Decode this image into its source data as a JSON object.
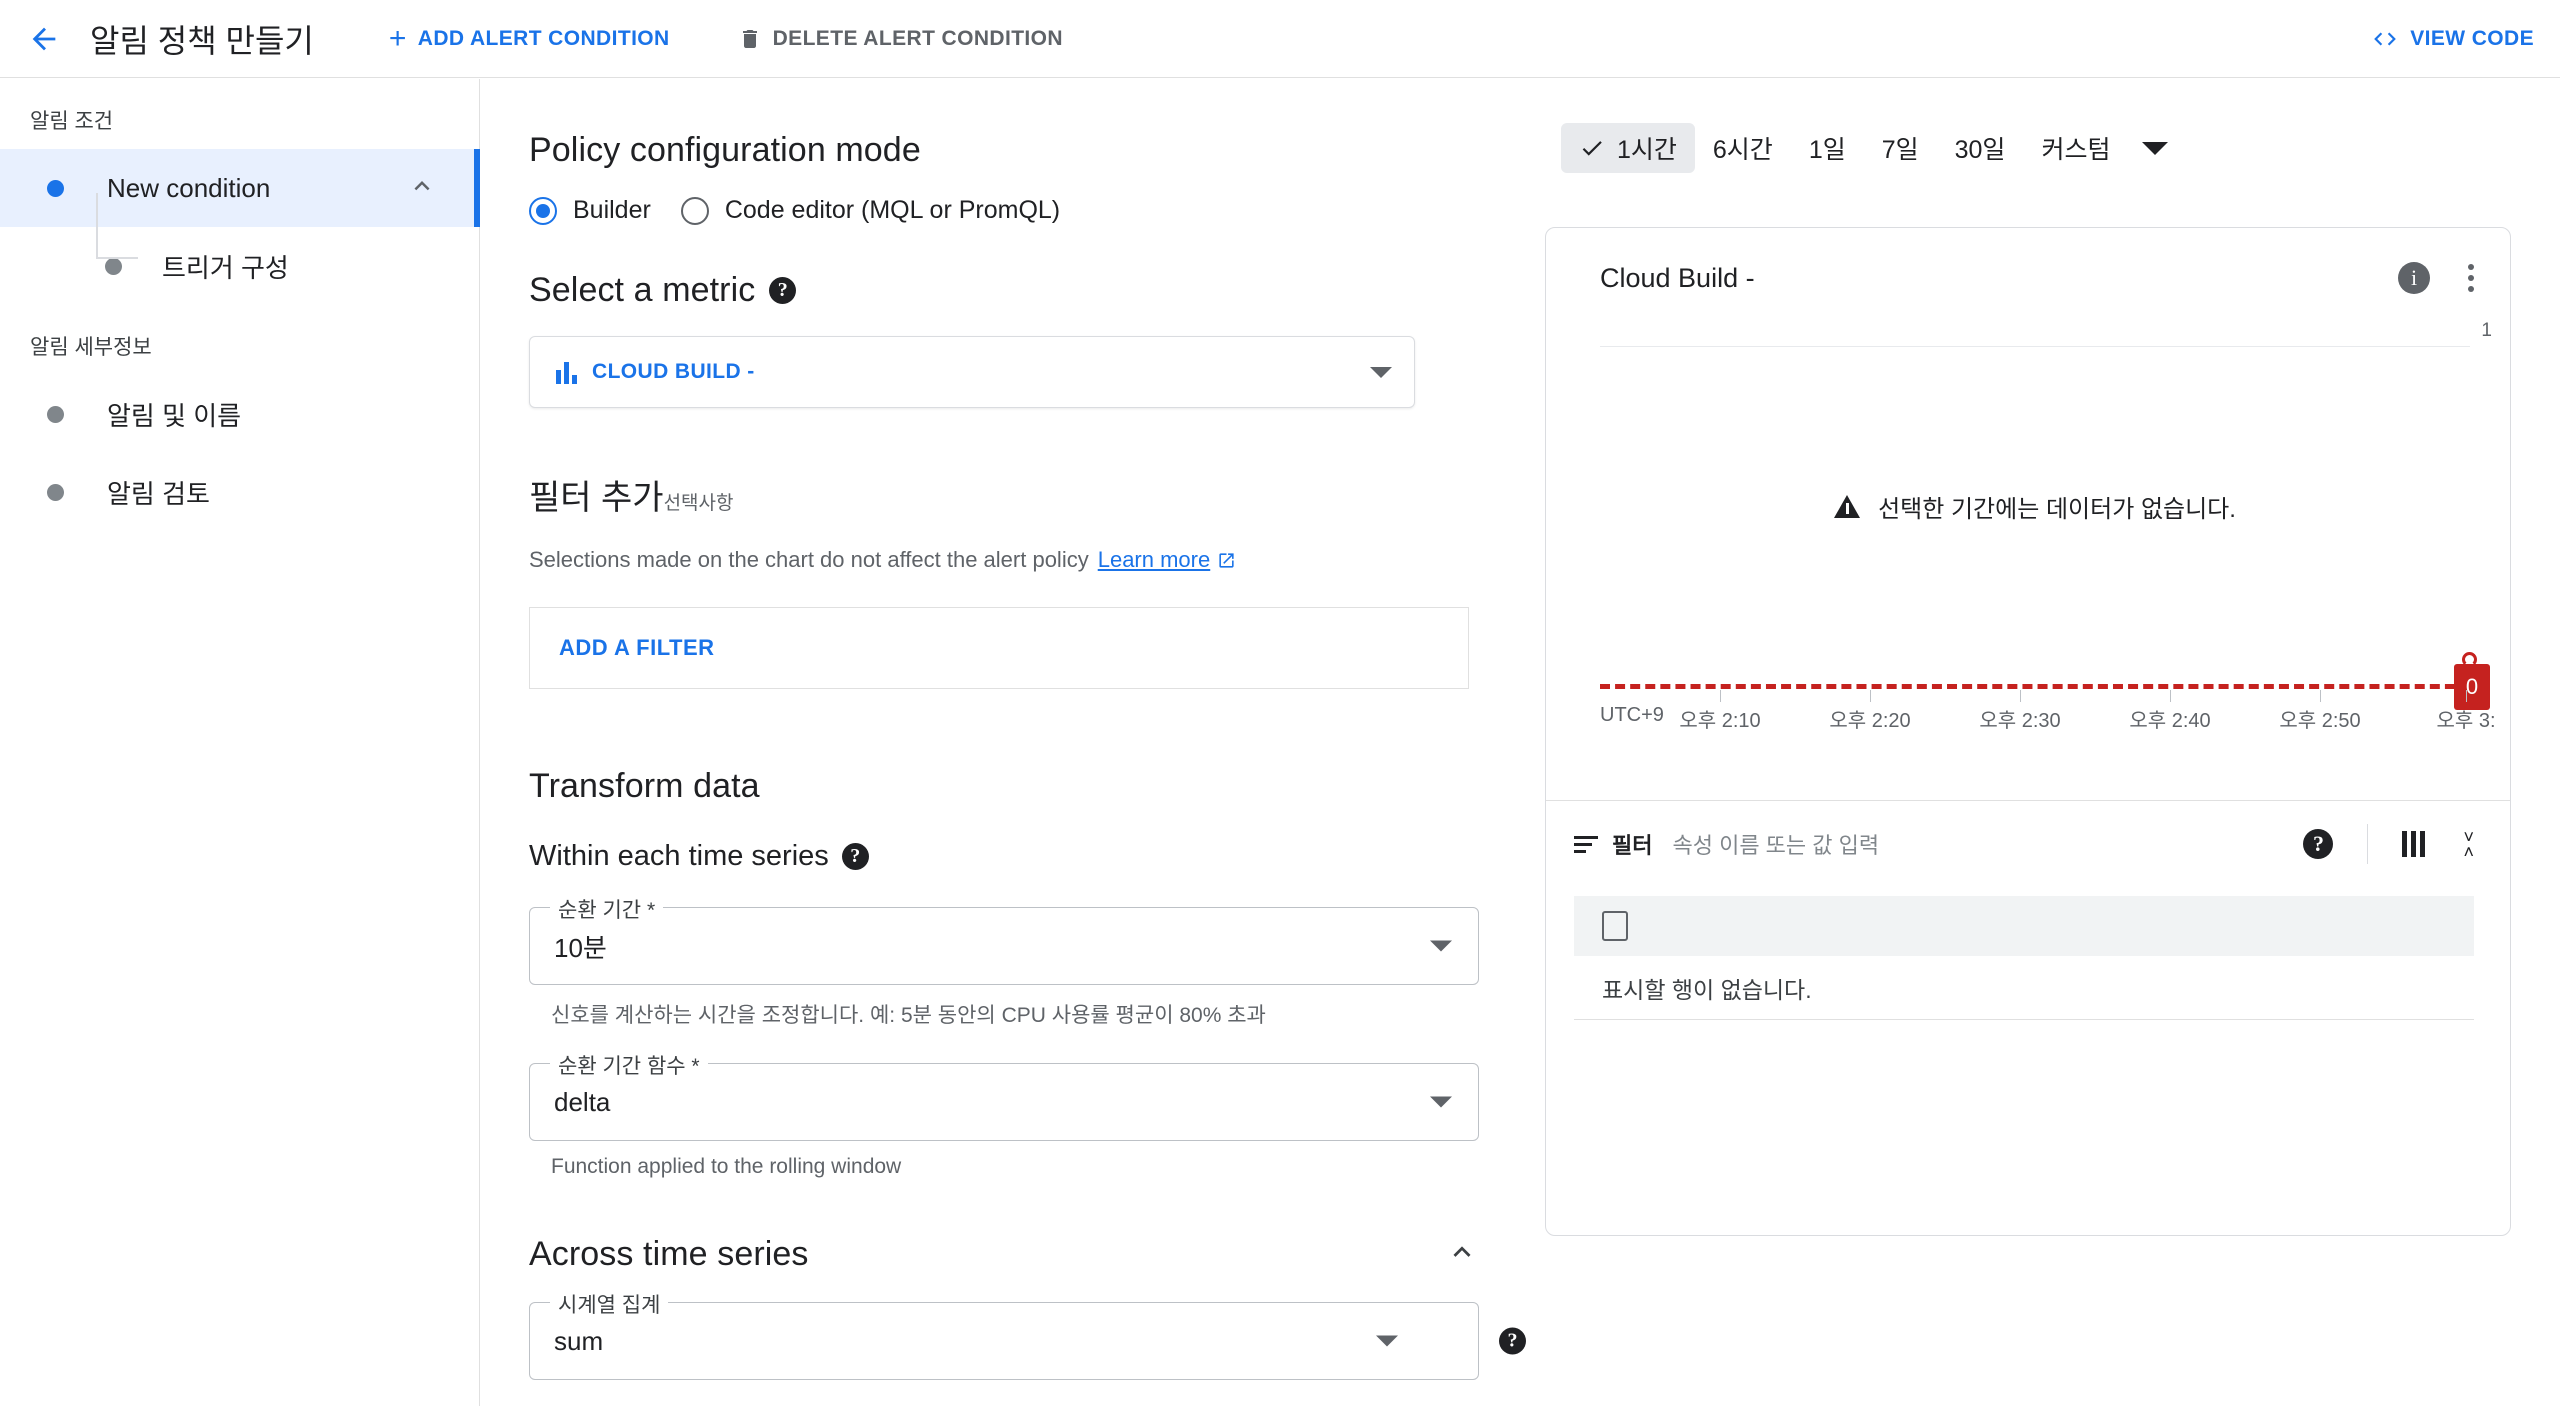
{
  "topbar": {
    "back_icon": "arrow-left-icon",
    "title": "알림 정책 만들기",
    "add_condition": "ADD ALERT CONDITION",
    "delete_condition": "DELETE ALERT CONDITION",
    "view_code": "VIEW CODE"
  },
  "sidebar": {
    "group1_label": "알림 조건",
    "group2_label": "알림 세부정보",
    "items": [
      {
        "label": "New condition",
        "active": true
      },
      {
        "label": "트리거 구성",
        "active": false
      },
      {
        "label": "알림 및 이름",
        "active": false
      },
      {
        "label": "알림 검토",
        "active": false
      }
    ]
  },
  "main": {
    "policy_mode_heading": "Policy configuration mode",
    "mode_builder": "Builder",
    "mode_code_editor": "Code editor (MQL or PromQL)",
    "select_metric_heading": "Select a metric",
    "metric_value": "CLOUD BUILD -",
    "add_filter_heading": "필터 추가",
    "add_filter_optional": "선택사항",
    "note_text": "Selections made on the chart do not affect the alert policy",
    "note_link": "Learn more",
    "add_filter_button": "ADD A FILTER",
    "transform_heading": "Transform data",
    "within_each_heading": "Within each time series",
    "rolling_window_label": "순환 기간 *",
    "rolling_window_value": "10분",
    "rolling_window_help": "신호를 계산하는 시간을 조정합니다. 예: 5분 동안의 CPU 사용률 평균이 80% 초과",
    "rolling_fn_label": "순환 기간 함수 *",
    "rolling_fn_value": "delta",
    "rolling_fn_help": "Function applied to the rolling window",
    "across_heading": "Across time series",
    "series_agg_label": "시계열 집계",
    "series_agg_value": "sum"
  },
  "right": {
    "ranges": [
      {
        "label": "1시간",
        "selected": true
      },
      {
        "label": "6시간",
        "selected": false
      },
      {
        "label": "1일",
        "selected": false
      },
      {
        "label": "7일",
        "selected": false
      },
      {
        "label": "30일",
        "selected": false
      },
      {
        "label": "커스텀",
        "selected": false
      }
    ],
    "card_title": "Cloud Build -",
    "no_data_message": "선택한 기간에는 데이터가 없습니다.",
    "threshold_badge": "0",
    "table": {
      "filter_label": "필터",
      "filter_placeholder": "속성 이름 또는 값 입력",
      "empty_message": "표시할 행이 없습니다."
    }
  },
  "chart_data": {
    "type": "line",
    "title": "Cloud Build -",
    "xlabel": "",
    "ylabel": "",
    "timezone_label": "UTC+9",
    "x_tick_labels": [
      "오후 2:10",
      "오후 2:20",
      "오후 2:30",
      "오후 2:40",
      "오후 2:50",
      "오후 3:"
    ],
    "y_tick_labels": [
      "1"
    ],
    "ylim": [
      0,
      1
    ],
    "grid": true,
    "legend": "none",
    "series": [
      {
        "name": "Cloud Build -",
        "values": []
      }
    ],
    "annotations": [
      {
        "type": "threshold-line",
        "value": 0,
        "color": "#c5221f",
        "style": "dashed",
        "label": "0"
      },
      {
        "type": "no-data",
        "text": "선택한 기간에는 데이터가 없습니다."
      }
    ]
  }
}
